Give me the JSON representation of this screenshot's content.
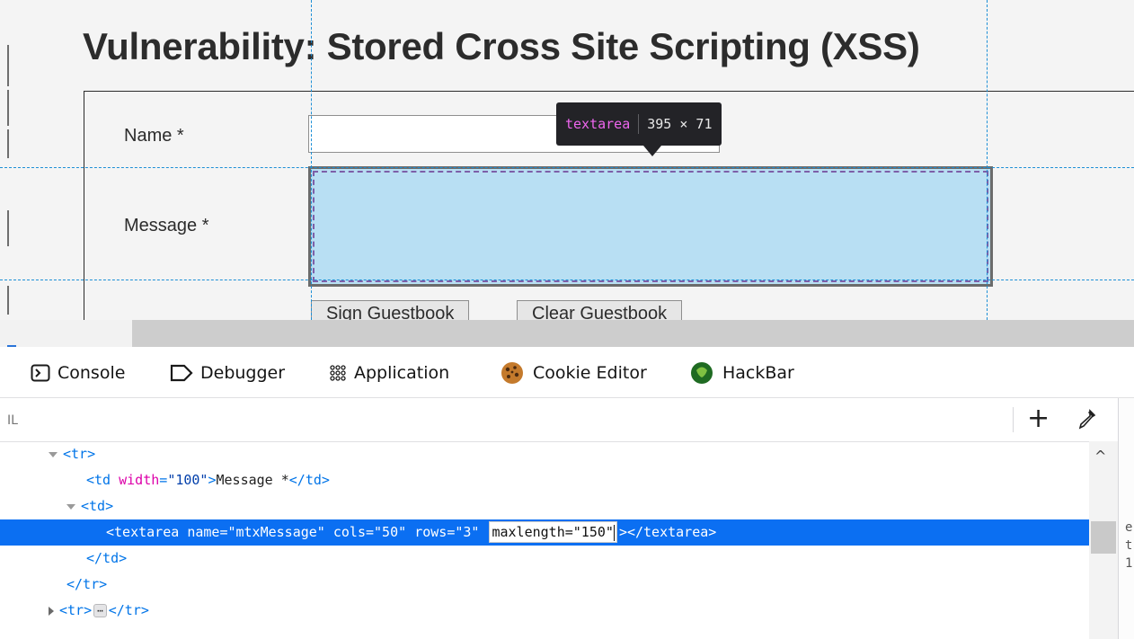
{
  "page": {
    "heading": "Vulnerability: Stored Cross Site Scripting (XSS)",
    "name_label": "Name *",
    "message_label": "Message *",
    "sign_button": "Sign Guestbook",
    "clear_button": "Clear Guestbook"
  },
  "highlighter": {
    "tag": "textarea",
    "dimensions": "395 × 71"
  },
  "devtools": {
    "tabs": [
      {
        "label": "Console",
        "icon": "console-icon"
      },
      {
        "label": "Debugger",
        "icon": "debugger-icon"
      },
      {
        "label": "Application",
        "icon": "application-grid-icon"
      },
      {
        "label": "Cookie Editor",
        "icon": "cookie-icon"
      },
      {
        "label": "HackBar",
        "icon": "hackbar-icon"
      }
    ],
    "search_placeholder": "IL",
    "add_node_label": "+",
    "markup": {
      "l1_open": "<tr>",
      "l2_open_td": "<td ",
      "l2_attr": "width",
      "l2_eq": "=",
      "l2_val": "\"100\"",
      "l2_gt": ">",
      "l2_text": "Message *",
      "l2_close": "</td>",
      "l3_open": "<td>",
      "l4_open": "<textarea ",
      "l4_a1": "name",
      "l4_v1": "\"mtxMessage\"",
      "l4_a2": "cols",
      "l4_v2": "\"50\"",
      "l4_a3": "rows",
      "l4_v3": "\"3\"",
      "l4_edit": "maxlength=\"150\"",
      "l4_close": "></textarea>",
      "l5_close": "</td>",
      "l6_close": "</tr>",
      "l7_open": "<tr>",
      "l7_ellipsis": "⋯",
      "l7_close": "</tr>"
    },
    "side_fragments": [
      "e",
      "t",
      "1"
    ]
  },
  "colors": {
    "selection": "#0b6ff2",
    "highlight_fill": "#b8dff3",
    "guide_lines": "#1d8fd6",
    "tooltip_bg": "#232327",
    "tooltip_tag": "#ee66ee"
  }
}
